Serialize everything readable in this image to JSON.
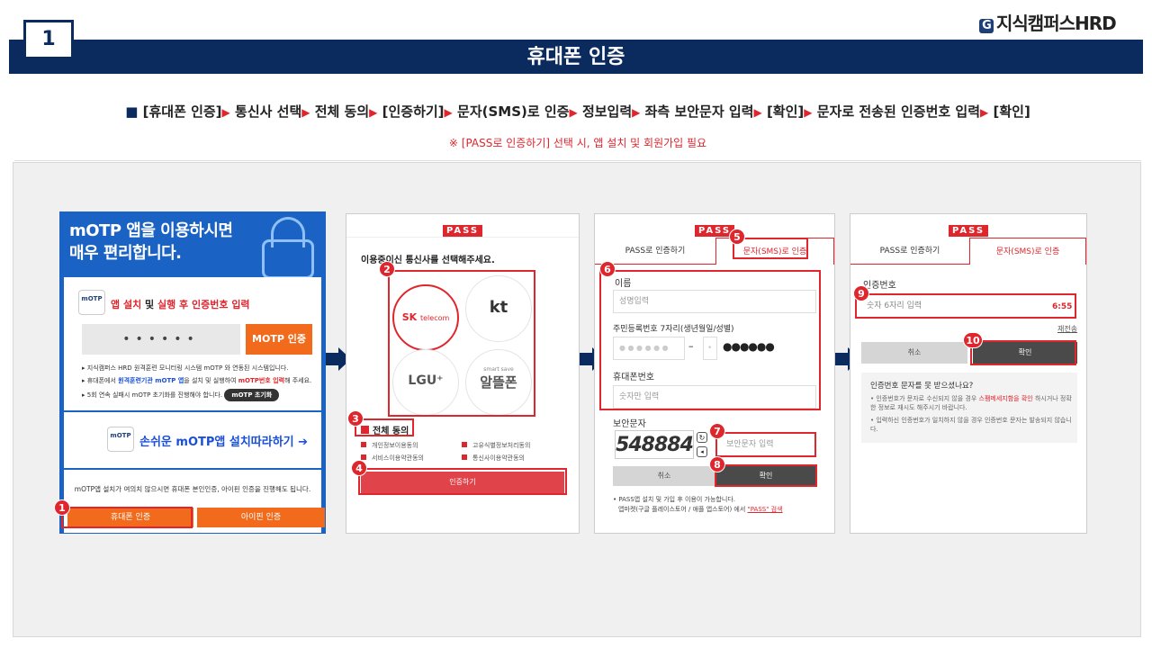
{
  "header": {
    "brand_g": "G",
    "brand": "지식캠퍼스HRD",
    "step_number": "1",
    "title": "휴대폰 인증"
  },
  "instructions": {
    "bullet": "■",
    "arrow": "▶",
    "steps": [
      "[휴대폰 인증]",
      "통신사 선택",
      "전체 동의",
      "[인증하기]",
      "문자(SMS)로 인증",
      "정보입력",
      "좌측 보안문자 입력",
      "[확인]",
      "문자로 전송된 인증번호 입력",
      "[확인]"
    ],
    "note": "※ [PASS로 인증하기] 선택 시, 앱 설치 및 회원가입 필요"
  },
  "panel1": {
    "hero_line1": "mOTP 앱을 이용하시면",
    "hero_line2": "매우 편리합니다.",
    "logo_text": "mOTP",
    "install_title_a": "앱 설치",
    "install_title_b": " 및 ",
    "install_title_c": "실행 후 인증번호 입력",
    "pin_mask": "••••••",
    "motp_button": "MOTP 인증",
    "bullet1": "▸ 지식캠퍼스 HRD 원격훈련 모니터링 시스템 mOTP 와 연동된 시스템입니다.",
    "bullet2_a": "▸ 휴대폰에서 ",
    "bullet2_b": "원격훈련기관 mOTP 앱",
    "bullet2_c": "을 설치 및 실행하여 ",
    "bullet2_d": "mOTP번호 입력",
    "bullet2_e": "해 주세요.",
    "bullet3": "▸ 5회 연속 실패시 mOTP 초기화를 진행해야 합니다.",
    "reset_button": "mOTP 초기화",
    "install_link": "손쉬운 mOTP앱 설치따라하기 ➔",
    "footer_text": "mOTP앱 설치가 여의치 않으시면 휴대폰 본인인증, 아이핀 인증을 진행해도 됩니다.",
    "phone_auth_button": "휴대폰 인증",
    "ipin_button": "아이핀 인증"
  },
  "panel2": {
    "pass_logo": "PASS",
    "prompt": "이용중이신 통신사를 선택해주세요.",
    "carriers": {
      "sk_a": "SK",
      "sk_b": "telecom",
      "kt": "kt",
      "lgu": "LGU⁺",
      "alddle_small": "smart save",
      "alddle": "알뜰폰"
    },
    "agree_all": "전체 동의",
    "terms": [
      "개인정보이용동의",
      "고유식별정보처리동의",
      "서비스이용약관동의",
      "통신사이용약관동의"
    ],
    "auth_button": "인증하기"
  },
  "panel3": {
    "pass_logo": "PASS",
    "tab_pass": "PASS로 인증하기",
    "tab_sms": "문자(SMS)로 인증",
    "name_label": "이름",
    "name_placeholder": "성명입력",
    "rrn_label": "주민등록번호 7자리(생년월일/성별)",
    "rrn_front": "● ● ● ● ● ●",
    "rrn_dash": "–",
    "rrn_back_mask": "●●●●●●",
    "phone_label": "휴대폰번호",
    "phone_placeholder": "숫자만 입력",
    "captcha_label": "보안문자",
    "captcha_text": "548884",
    "captcha_placeholder": "보안문자 입력",
    "cancel": "취소",
    "confirm": "확인",
    "foot1": "• PASS앱 설치 및 가입 후 이용이 가능합니다.",
    "foot2": "앱마켓(구글 플레이스토어 / 애플 앱스토어) 에서 ",
    "foot3": "\"PASS\" 검색"
  },
  "panel4": {
    "pass_logo": "PASS",
    "tab_pass": "PASS로 인증하기",
    "tab_sms": "문자(SMS)로 인증",
    "code_label": "인증번호",
    "code_placeholder": "숫자 6자리 입력",
    "timer": "6:55",
    "resend": "재전송",
    "cancel": "취소",
    "confirm": "확인",
    "help_title": "인증번호 문자를 못 받으셨나요?",
    "help1_a": "• 인증번호가 문자로 수신되지 않을 경우 ",
    "help1_b": "스팸메세지함을 확인",
    "help1_c": " 하시거나 정확한 정보로 재시도 해주시기 바랍니다.",
    "help2": "• 입력하신 인증번호가 일치하지 않을 경우 인증번호 문자는 발송되지 않습니다."
  },
  "markers": [
    "1",
    "2",
    "3",
    "4",
    "5",
    "6",
    "7",
    "8",
    "9",
    "10"
  ],
  "colors": {
    "navy": "#0b2a5e",
    "red": "#e0262d",
    "orange": "#f26a1b",
    "blue": "#1a63c4"
  }
}
